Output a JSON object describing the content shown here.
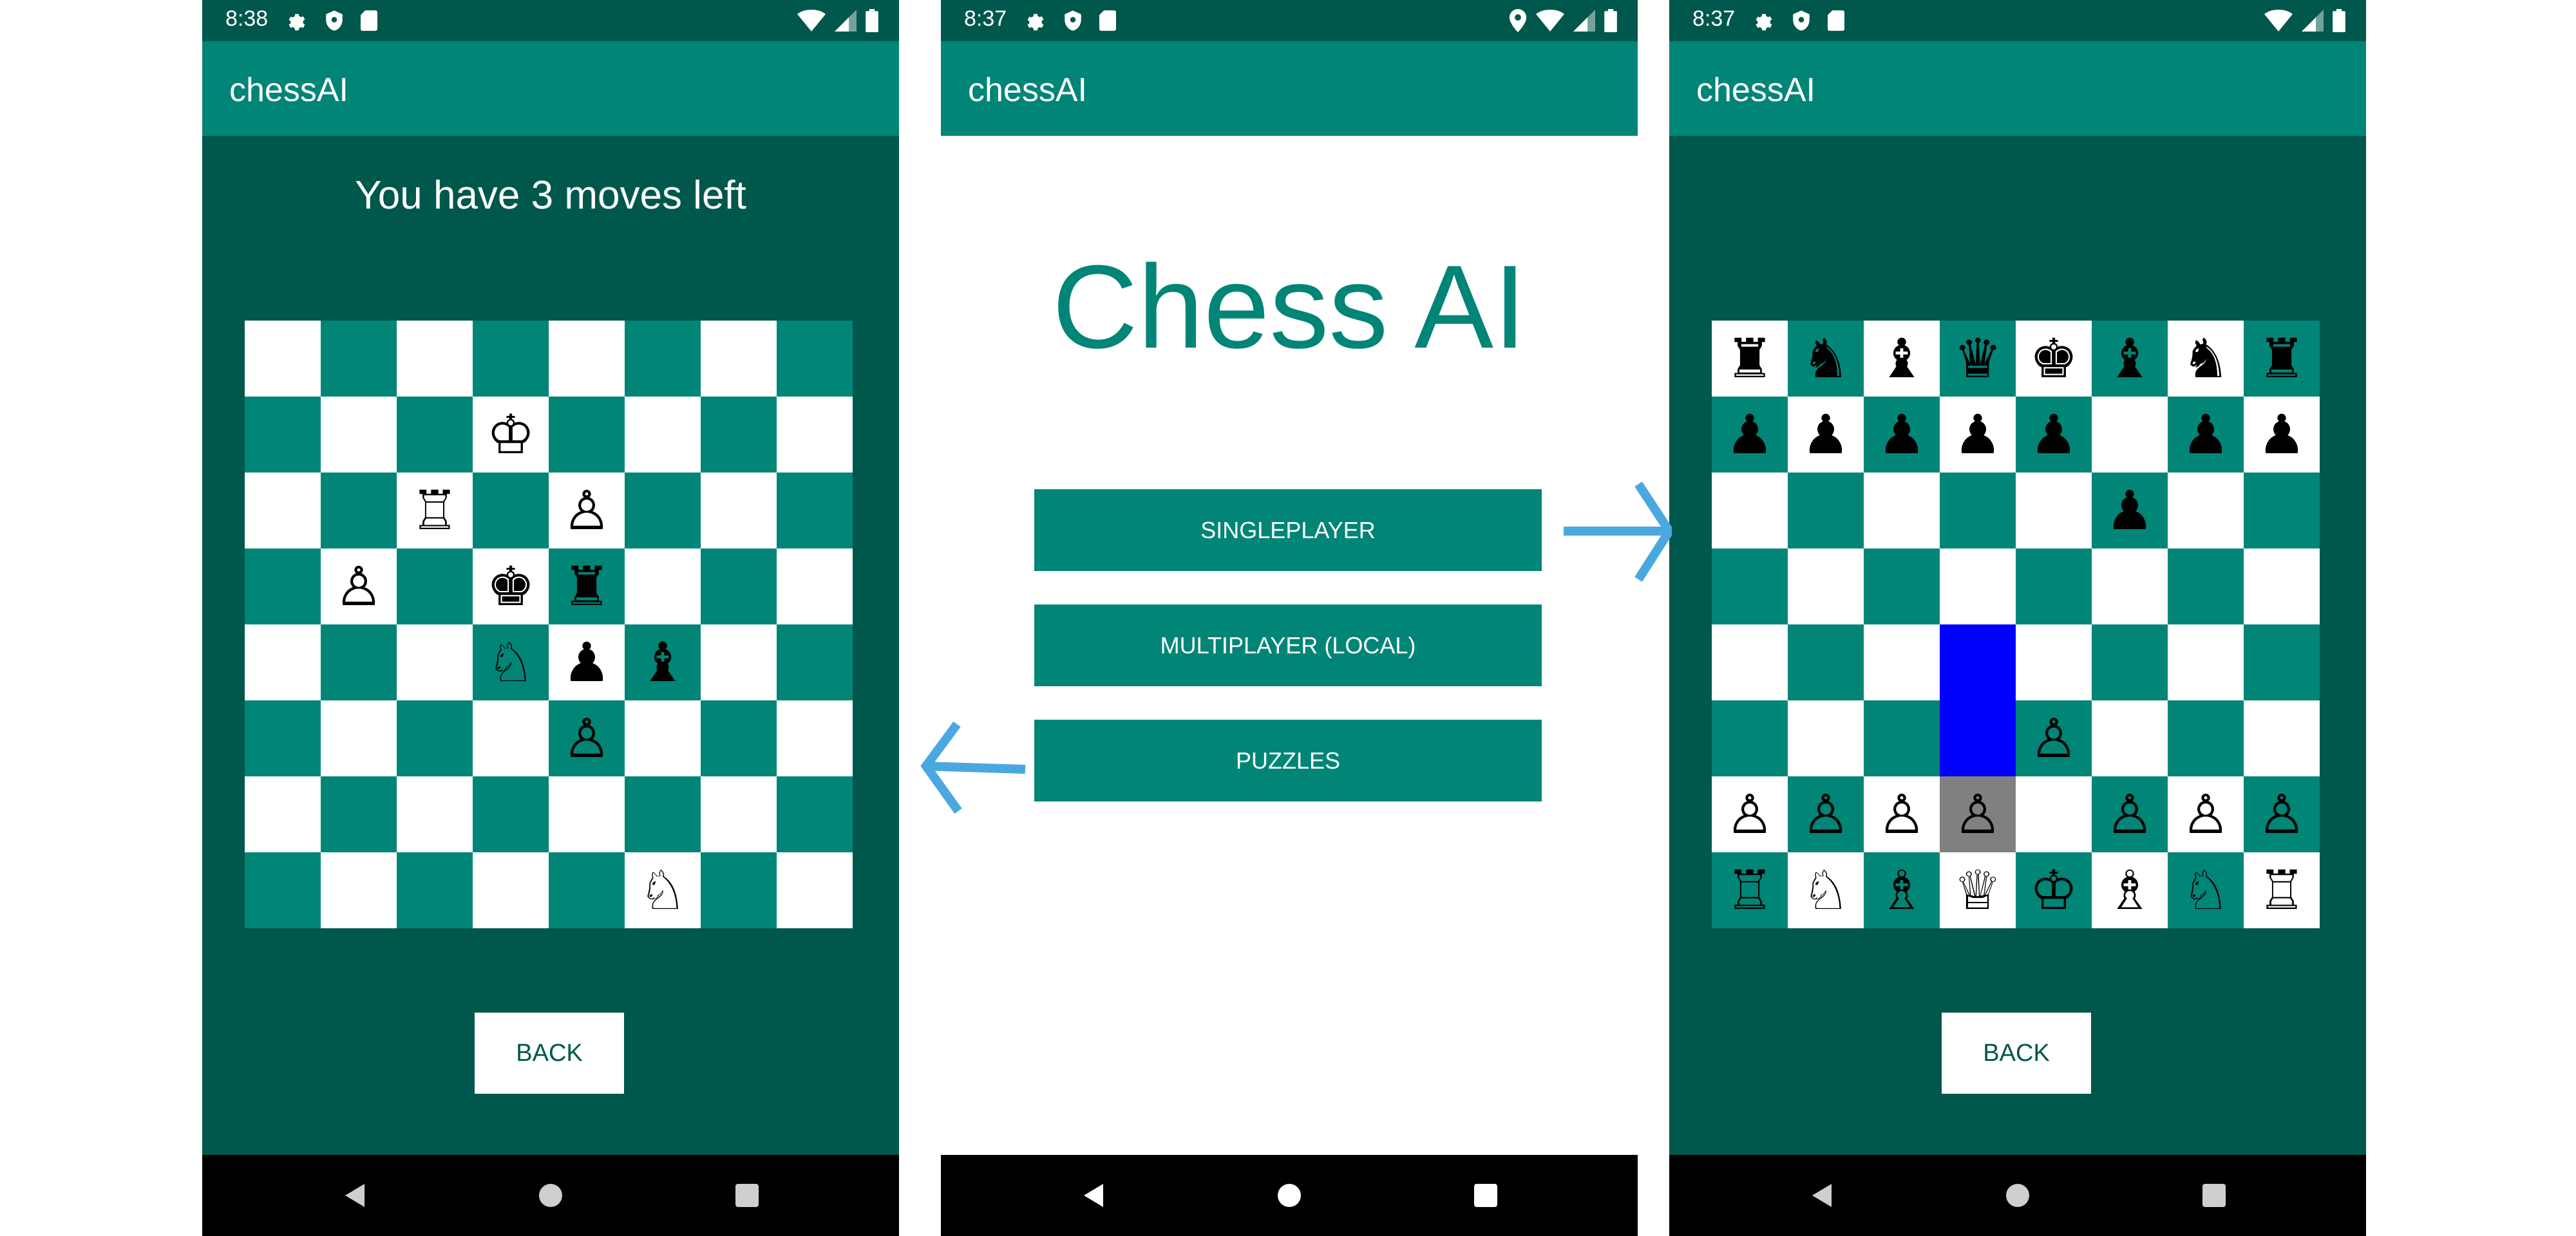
{
  "colors": {
    "primary_dark": "#00574B",
    "primary": "#008577",
    "board_light": "#ffffff",
    "board_dark": "#008577",
    "highlight_blue": "#0000FF",
    "highlight_gray": "#808080",
    "arrow": "#4AA8E0"
  },
  "screens": {
    "left": {
      "status_time": "8:38",
      "status_icons": [
        "gear-icon",
        "shield-icon",
        "sd-card-icon",
        "wifi-icon",
        "signal-icon",
        "battery-icon"
      ],
      "app_title": "chessAI",
      "moves_left_text": "You have 3 moves left",
      "back_label": "BACK",
      "board": [
        [
          "",
          "",
          "",
          "",
          "",
          "",
          "",
          ""
        ],
        [
          "",
          "",
          "",
          "♔",
          "",
          "",
          "",
          ""
        ],
        [
          "",
          "",
          "♖",
          "",
          "♙",
          "",
          "",
          ""
        ],
        [
          "",
          "♙",
          "",
          "♚",
          "♜",
          "",
          "",
          ""
        ],
        [
          "",
          "",
          "",
          "♘",
          "♟",
          "♝",
          "",
          ""
        ],
        [
          "",
          "",
          "",
          "",
          "♙",
          "",
          "",
          ""
        ],
        [
          "",
          "",
          "",
          "",
          "",
          "",
          "",
          ""
        ],
        [
          "",
          "",
          "",
          "",
          "",
          "♘",
          "",
          ""
        ]
      ]
    },
    "center": {
      "status_time": "8:37",
      "status_icons": [
        "gear-icon",
        "shield-icon",
        "sd-card-icon",
        "location-icon",
        "wifi-icon",
        "signal-icon",
        "battery-icon"
      ],
      "app_title": "chessAI",
      "big_title": "Chess AI",
      "buttons": {
        "singleplayer": "SINGLEPLAYER",
        "multiplayer": "MULTIPLAYER (LOCAL)",
        "puzzles": "PUZZLES"
      }
    },
    "right": {
      "status_time": "8:37",
      "status_icons": [
        "gear-icon",
        "shield-icon",
        "sd-card-icon",
        "wifi-icon",
        "signal-icon",
        "battery-icon"
      ],
      "app_title": "chessAI",
      "back_label": "BACK",
      "highlighted_squares": {
        "blue": [
          [
            4,
            3
          ],
          [
            5,
            3
          ]
        ],
        "gray": [
          [
            6,
            3
          ]
        ]
      },
      "board": [
        [
          "♜",
          "♞",
          "♝",
          "♛",
          "♚",
          "♝",
          "♞",
          "♜"
        ],
        [
          "♟",
          "♟",
          "♟",
          "♟",
          "♟",
          "",
          "♟",
          "♟"
        ],
        [
          "",
          "",
          "",
          "",
          "",
          "♟",
          "",
          ""
        ],
        [
          "",
          "",
          "",
          "",
          "",
          "",
          "",
          ""
        ],
        [
          "",
          "",
          "",
          "",
          "",
          "",
          "",
          ""
        ],
        [
          "",
          "",
          "",
          "",
          "♙",
          "",
          "",
          ""
        ],
        [
          "♙",
          "♙",
          "♙",
          "♙",
          "",
          "♙",
          "♙",
          "♙"
        ],
        [
          "♖",
          "♘",
          "♗",
          "♕",
          "♔",
          "♗",
          "♘",
          "♖"
        ]
      ]
    }
  },
  "navigation": {
    "nav_buttons": [
      "back-triangle-icon",
      "home-circle-icon",
      "recents-square-icon"
    ]
  }
}
